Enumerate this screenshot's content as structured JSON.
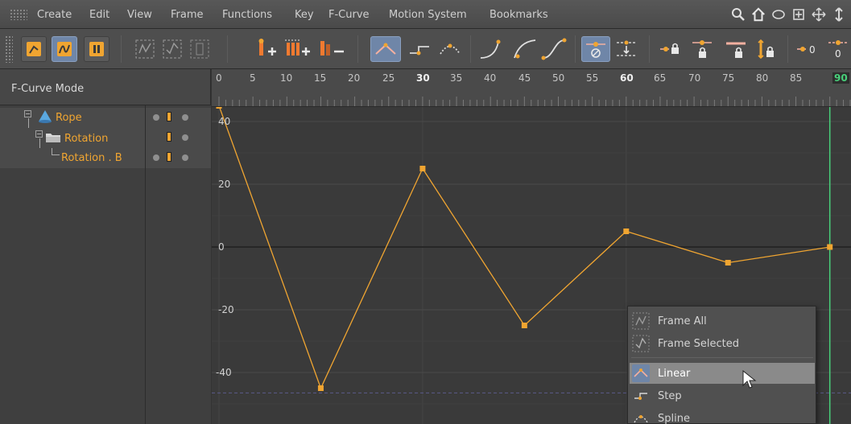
{
  "menubar": {
    "items": [
      "Create",
      "Edit",
      "View",
      "Frame",
      "Functions",
      "Key",
      "F-Curve",
      "Motion System",
      "Bookmarks"
    ],
    "right_icons": [
      "search-icon",
      "home-icon",
      "circle-icon",
      "frame-icon",
      "move-icon",
      "arrows-icon"
    ]
  },
  "toolbar": {
    "groups": [
      [
        "key-mode-icon",
        "f-curve-mode-icon",
        "motion-mode-icon"
      ],
      [
        "frame-all-icon",
        "frame-selected-icon",
        "ghost-icon"
      ],
      [
        "add-key-icon",
        "add-keys-icon",
        "remove-key-icon"
      ],
      [
        "linear-icon",
        "step-icon",
        "spline-icon"
      ],
      [
        "ease-in-icon",
        "ease-out-icon",
        "ease-icon"
      ],
      [
        "zero-angle-icon",
        "zero-length-icon"
      ],
      [
        "lock-tangent-icon",
        "lock-time-icon",
        "lock-value-icon",
        "lock-length-icon"
      ],
      [
        "zero-tangent-icon",
        "zero-value-icon"
      ]
    ]
  },
  "left": {
    "mode_label": "F-Curve Mode",
    "tree": [
      {
        "label": "Rope",
        "icon": "cone-icon"
      },
      {
        "label": "Rotation",
        "icon": "folder-icon"
      },
      {
        "label": "Rotation . B",
        "icon": ""
      }
    ]
  },
  "ruler": {
    "ticks": [
      "0",
      "5",
      "10",
      "15",
      "20",
      "25",
      "30",
      "35",
      "40",
      "45",
      "50",
      "55",
      "60",
      "65",
      "70",
      "75",
      "80",
      "85"
    ],
    "current_frame": "90"
  },
  "graph": {
    "y_labels": [
      "40",
      "20",
      "0",
      "-20",
      "-40"
    ],
    "curve_color": "#f0a531",
    "playhead_color": "#48d07a"
  },
  "chart_data": {
    "type": "line",
    "title": "",
    "xlabel": "",
    "ylabel": "",
    "x": [
      0,
      15,
      30,
      45,
      60,
      75,
      90
    ],
    "series": [
      {
        "values": [
          45,
          -45,
          25,
          -25,
          5,
          -5,
          0
        ]
      }
    ],
    "xlim": [
      0,
      90
    ],
    "ylim": [
      -50,
      45
    ],
    "grid": true
  },
  "context_menu": {
    "items": [
      {
        "label": "Frame All",
        "icon": "frame-all-icon"
      },
      {
        "label": "Frame Selected",
        "icon": "frame-selected-icon"
      },
      {
        "label": "Linear",
        "icon": "linear-icon",
        "highlighted": true
      },
      {
        "label": "Step",
        "icon": "step-icon"
      },
      {
        "label": "Spline",
        "icon": "spline-icon"
      }
    ]
  }
}
